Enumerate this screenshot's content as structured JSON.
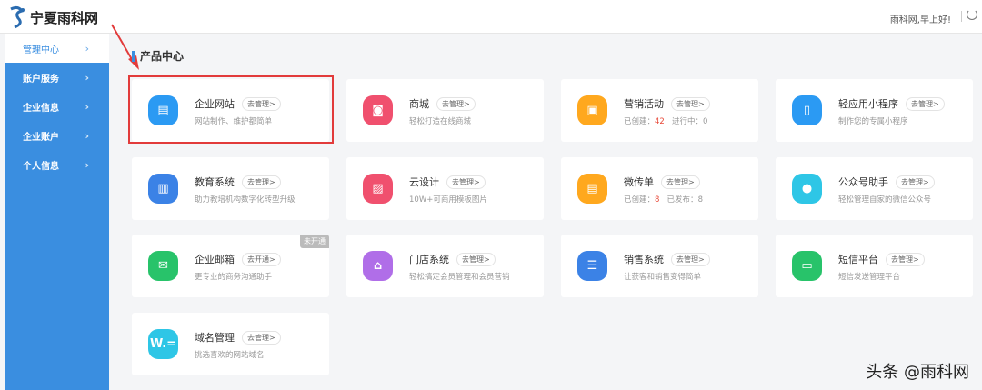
{
  "header": {
    "logo_text": "宁夏雨科网",
    "greeting": "雨科网,早上好!"
  },
  "sidebar": {
    "items": [
      {
        "label": "管理中心",
        "active": true
      },
      {
        "label": "账户服务"
      },
      {
        "label": "企业信息"
      },
      {
        "label": "企业账户"
      },
      {
        "label": "个人信息"
      }
    ]
  },
  "section_title": "产品中心",
  "cards": [
    {
      "name": "企业网站",
      "button": "去管理>",
      "desc": "网站制作、维护都简单",
      "color": "#2b9af3",
      "icon": "browser-icon",
      "glyph": "▤"
    },
    {
      "name": "商城",
      "button": "去管理>",
      "desc": "轻松打造在线商城",
      "color": "#f0506e",
      "icon": "shopping-bag-icon",
      "glyph": "◙"
    },
    {
      "name": "营销活动",
      "button": "去管理>",
      "desc_parts": [
        "已创建：",
        "42",
        "进行中：",
        "0"
      ],
      "color": "#ffa81e",
      "icon": "gift-icon",
      "glyph": "▣"
    },
    {
      "name": "轻应用小程序",
      "button": "去管理>",
      "desc": "制作您的专属小程序",
      "color": "#2b9af3",
      "icon": "mini-program-icon",
      "glyph": "▯"
    },
    {
      "name": "教育系统",
      "button": "去管理>",
      "desc": "助力教培机构数字化转型升级",
      "color": "#3b82e6",
      "icon": "book-icon",
      "glyph": "▥"
    },
    {
      "name": "云设计",
      "button": "去管理>",
      "desc": "10W+可商用模板图片",
      "color": "#f0506e",
      "icon": "image-icon",
      "glyph": "▨"
    },
    {
      "name": "微传单",
      "button": "去管理>",
      "desc_parts": [
        "已创建：",
        "8",
        "已发布：",
        "8"
      ],
      "color": "#ffa81e",
      "icon": "flyer-icon",
      "glyph": "▤"
    },
    {
      "name": "公众号助手",
      "button": "去管理>",
      "desc": "轻松管理自家的微信公众号",
      "color": "#2ec6e6",
      "icon": "wechat-icon",
      "glyph": "●"
    },
    {
      "name": "企业邮箱",
      "button": "去开通>",
      "desc": "更专业的商务沟通助手",
      "color": "#28c36a",
      "icon": "mail-icon",
      "glyph": "✉",
      "tag": "未开通"
    },
    {
      "name": "门店系统",
      "button": "去管理>",
      "desc": "轻松搞定会员管理和会员营销",
      "color": "#b06ee8",
      "icon": "store-icon",
      "glyph": "⌂"
    },
    {
      "name": "销售系统",
      "button": "去管理>",
      "desc": "让获客和销售变得简单",
      "color": "#3b82e6",
      "icon": "list-icon",
      "glyph": "☰"
    },
    {
      "name": "短信平台",
      "button": "去管理>",
      "desc": "短信发送管理平台",
      "color": "#28c36a",
      "icon": "message-icon",
      "glyph": "▭"
    },
    {
      "name": "域名管理",
      "button": "去管理>",
      "desc": "挑选喜欢的网站域名",
      "color": "#2ec6e6",
      "icon": "domain-icon",
      "glyph": "W.="
    }
  ],
  "watermark": "头条 @雨科网"
}
